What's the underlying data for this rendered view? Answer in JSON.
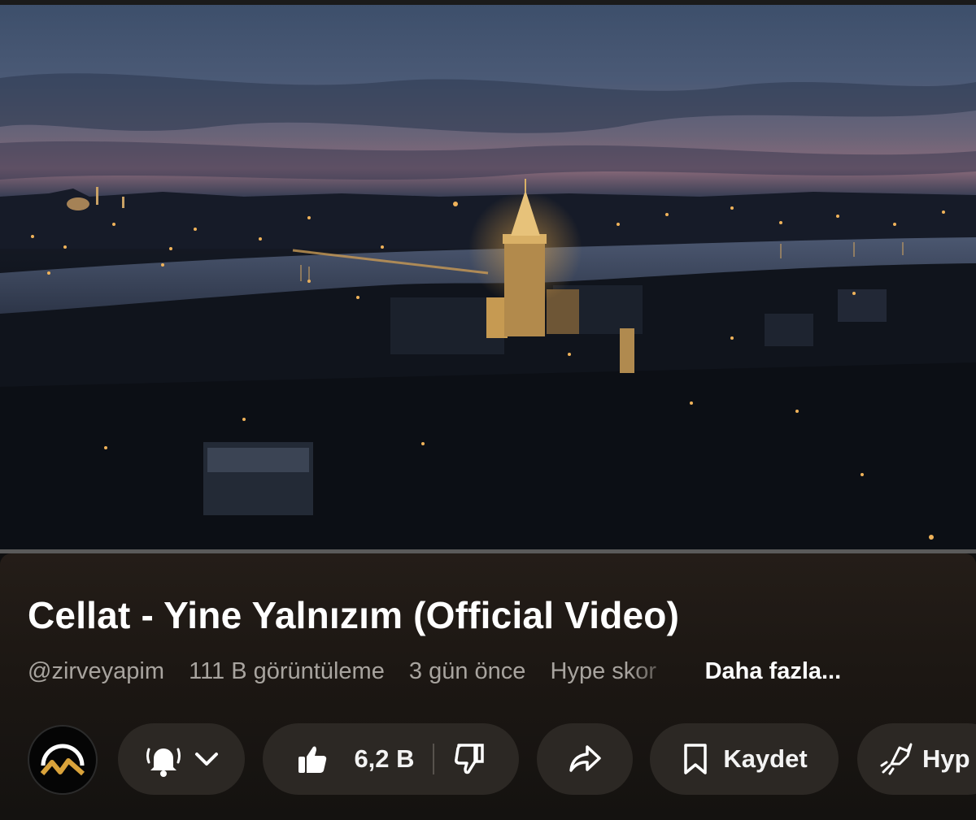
{
  "video": {
    "title": "Cellat - Yine Yalnızım (Official Video)",
    "progress_percent": 0
  },
  "meta": {
    "channel": "@zirveyapim",
    "views": "111 B görüntüleme",
    "age": "3 gün önce",
    "hype": "Hype skor",
    "more_label": "Daha fazla..."
  },
  "actions": {
    "like_count": "6,2 B",
    "save_label": "Kaydet",
    "hype_label": "Hyp"
  },
  "icons": {
    "avatar": "channel-logo-mountains",
    "subscribe": "bell-icon",
    "dropdown": "chevron-down-icon",
    "like": "thumbs-up-icon",
    "dislike": "thumbs-down-icon",
    "share": "share-arrow-icon",
    "save": "bookmark-icon",
    "hype": "rocket-icon"
  },
  "colors": {
    "progress": "#ff0033",
    "pill_bg": "#2c2824",
    "accent_gold": "#d9a23a"
  }
}
